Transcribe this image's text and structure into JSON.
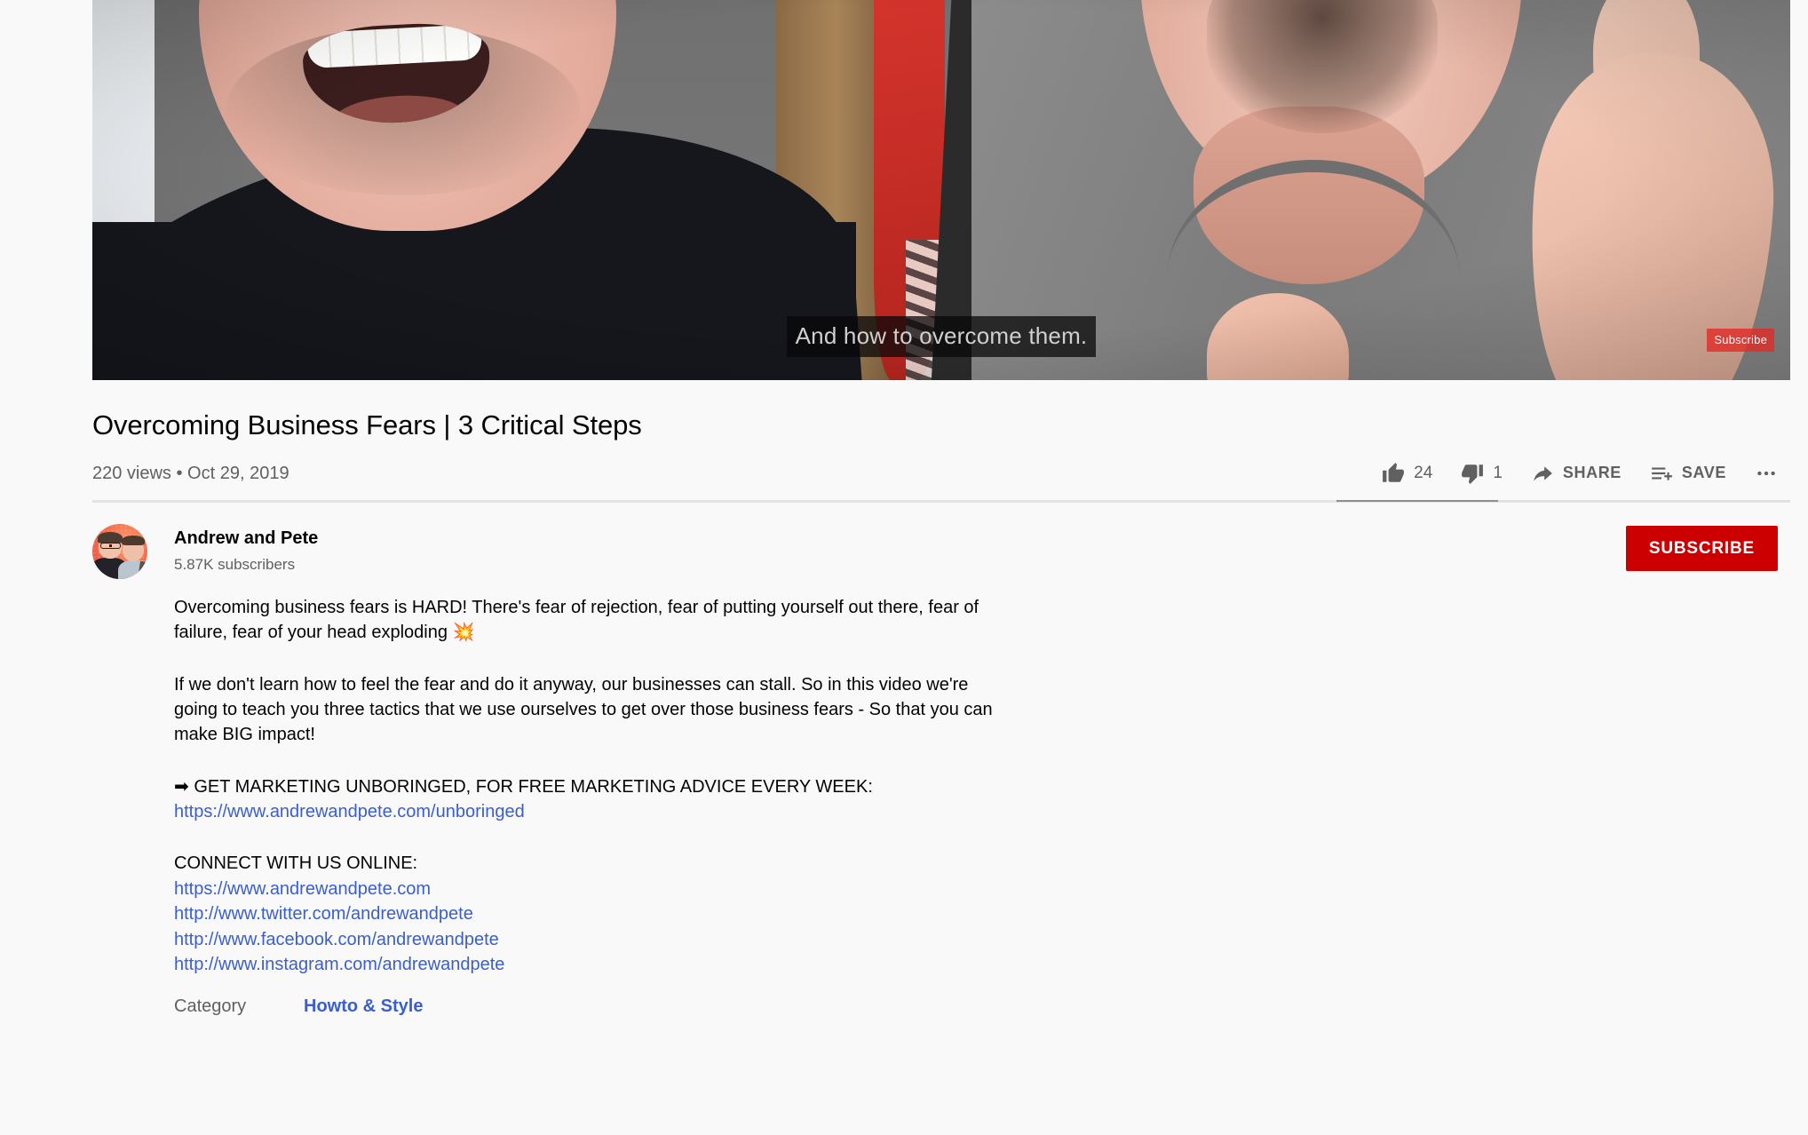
{
  "video": {
    "caption_overlay": "And how to overcome them.",
    "subscribe_watermark": "Subscribe"
  },
  "info": {
    "title": "Overcoming Business Fears | 3 Critical Steps",
    "views_and_date": "220 views • Oct 29, 2019"
  },
  "actions": {
    "like_count": "24",
    "dislike_count": "1",
    "share_label": "SHARE",
    "save_label": "SAVE",
    "more_label": "•••"
  },
  "channel": {
    "name": "Andrew and Pete",
    "subscribers": "5.87K subscribers",
    "subscribe_label": "SUBSCRIBE"
  },
  "description": {
    "paragraph_1": "Overcoming business fears is HARD! There's fear of rejection, fear of putting yourself out there, fear of failure, fear of your head exploding 💥",
    "paragraph_2": "If we don't learn how to feel the fear and do it anyway, our businesses can stall. So in this video we're going to teach you three tactics that we use ourselves to get over those business fears - So that you can make BIG impact!",
    "unboringed_heading": "➡ GET MARKETING UNBORINGED, FOR FREE MARKETING ADVICE EVERY WEEK:",
    "unboringed_link": "https://www.andrewandpete.com/unboringed",
    "connect_heading": "CONNECT WITH US ONLINE:",
    "links": [
      "https://www.andrewandpete.com",
      "http://www.twitter.com/andrewandpete",
      "http://www.facebook.com/andrewandpete",
      "http://www.instagram.com/andrewandpete"
    ]
  },
  "category": {
    "label": "Category",
    "value": "Howto & Style"
  },
  "colors": {
    "subscribe_red": "#cc0000",
    "link_blue": "#3a5fcd",
    "page_background": "#f9f9f9",
    "secondary_text": "#606060"
  }
}
